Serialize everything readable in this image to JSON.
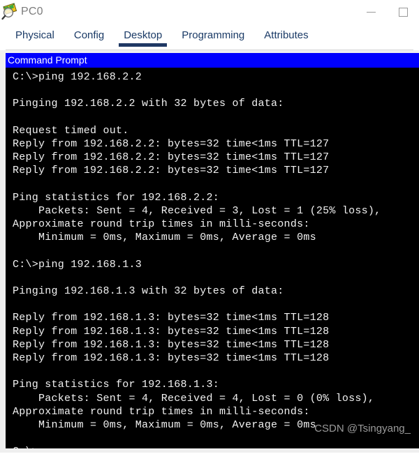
{
  "window": {
    "title": "PC0",
    "icon": "packet-tracer-pc-icon",
    "controls": {
      "minimize_label": "—",
      "maximize_label": "□"
    }
  },
  "tabs": [
    {
      "label": "Physical",
      "active": false
    },
    {
      "label": "Config",
      "active": false
    },
    {
      "label": "Desktop",
      "active": true
    },
    {
      "label": "Programming",
      "active": false
    },
    {
      "label": "Attributes",
      "active": false
    }
  ],
  "command_prompt": {
    "header_title": "Command Prompt",
    "header_bg": "#0000fe",
    "terminal_bg": "#000000",
    "terminal_fg": "#f2f2f2",
    "lines": [
      "C:\\>ping 192.168.2.2",
      "",
      "Pinging 192.168.2.2 with 32 bytes of data:",
      "",
      "Request timed out.",
      "Reply from 192.168.2.2: bytes=32 time<1ms TTL=127",
      "Reply from 192.168.2.2: bytes=32 time<1ms TTL=127",
      "Reply from 192.168.2.2: bytes=32 time<1ms TTL=127",
      "",
      "Ping statistics for 192.168.2.2:",
      "    Packets: Sent = 4, Received = 3, Lost = 1 (25% loss),",
      "Approximate round trip times in milli-seconds:",
      "    Minimum = 0ms, Maximum = 0ms, Average = 0ms",
      "",
      "C:\\>ping 192.168.1.3",
      "",
      "Pinging 192.168.1.3 with 32 bytes of data:",
      "",
      "Reply from 192.168.1.3: bytes=32 time<1ms TTL=128",
      "Reply from 192.168.1.3: bytes=32 time<1ms TTL=128",
      "Reply from 192.168.1.3: bytes=32 time<1ms TTL=128",
      "Reply from 192.168.1.3: bytes=32 time<1ms TTL=128",
      "",
      "Ping statistics for 192.168.1.3:",
      "    Packets: Sent = 4, Received = 4, Lost = 0 (0% loss),",
      "Approximate round trip times in milli-seconds:",
      "    Minimum = 0ms, Maximum = 0ms, Average = 0ms",
      "",
      "C:\\>"
    ]
  },
  "watermark": {
    "text": "CSDN @Tsingyang_"
  }
}
